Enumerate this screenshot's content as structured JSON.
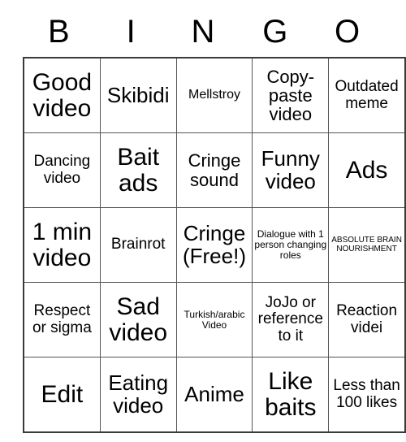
{
  "card": {
    "header_letters": [
      "B",
      "I",
      "N",
      "G",
      "O"
    ],
    "columns": 5,
    "rows": 5,
    "border_color": "#3a3a3a",
    "grid_line_color": "#555555",
    "background_color": "#ffffff",
    "text_color": "#000000",
    "cells": [
      [
        {
          "text": "Good video",
          "size": "xxl"
        },
        {
          "text": "Skibidi",
          "size": "xl"
        },
        {
          "text": "Mellstroy",
          "size": "sm"
        },
        {
          "text": "Copy-paste video",
          "size": "lg"
        },
        {
          "text": "Outdated meme",
          "size": "md"
        }
      ],
      [
        {
          "text": "Dancing video",
          "size": "md"
        },
        {
          "text": "Bait ads",
          "size": "xxl"
        },
        {
          "text": "Cringe sound",
          "size": "lg"
        },
        {
          "text": "Funny video",
          "size": "xl"
        },
        {
          "text": "Ads",
          "size": "xxl"
        }
      ],
      [
        {
          "text": "1 min video",
          "size": "xxl"
        },
        {
          "text": "Brainrot",
          "size": "md"
        },
        {
          "text": "Cringe (Free!)",
          "size": "xl"
        },
        {
          "text": "Dialogue with 1 person changing roles",
          "size": "xs"
        },
        {
          "text": "ABSOLUTE BRAIN NOURISHMENT",
          "size": "xxs"
        }
      ],
      [
        {
          "text": "Respect or sigma",
          "size": "md"
        },
        {
          "text": "Sad video",
          "size": "xxl"
        },
        {
          "text": "Turkish/arabic Video",
          "size": "xs"
        },
        {
          "text": "JoJo or reference to it",
          "size": "md"
        },
        {
          "text": "Reaction videi",
          "size": "md"
        }
      ],
      [
        {
          "text": "Edit",
          "size": "xxl"
        },
        {
          "text": "Eating video",
          "size": "xl"
        },
        {
          "text": "Anime",
          "size": "xl"
        },
        {
          "text": "Like baits",
          "size": "xxl"
        },
        {
          "text": "Less than 100 likes",
          "size": "md"
        }
      ]
    ]
  }
}
